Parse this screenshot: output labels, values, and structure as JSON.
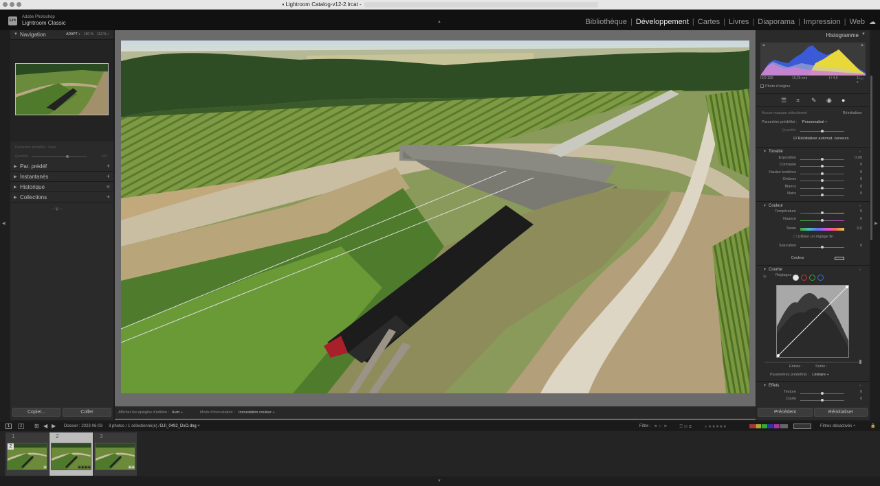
{
  "window": {
    "title": "Lightroom Catalog-v12-2.lrcat -"
  },
  "app": {
    "logo": "Lrc",
    "brand_top": "Adobe Photoshop",
    "brand_bottom": "Lightroom Classic"
  },
  "modules": [
    {
      "label": "Bibliothèque",
      "active": false
    },
    {
      "label": "Développement",
      "active": true
    },
    {
      "label": "Cartes",
      "active": false
    },
    {
      "label": "Livres",
      "active": false
    },
    {
      "label": "Diaporama",
      "active": false
    },
    {
      "label": "Impression",
      "active": false
    },
    {
      "label": "Web",
      "active": false
    }
  ],
  "left_panel": {
    "navigation": {
      "title": "Navigation",
      "zoom": [
        "ADAPT ÷",
        "100 %",
        "113 % ÷"
      ]
    },
    "preset_box": {
      "label": "Paramètre prédéfini : Sans",
      "amount_label": "Quantité",
      "amount_value": "100"
    },
    "sections": [
      {
        "title": "Par. prédéf",
        "action": "+"
      },
      {
        "title": "Instantanés",
        "action": "+"
      },
      {
        "title": "Historique",
        "action": "×"
      },
      {
        "title": "Collections",
        "action": "+"
      }
    ],
    "copy": "Copier...",
    "paste": "Coller"
  },
  "toolbar": {
    "pins_label": "Afficher les épingles d'édition :",
    "pins_value": "Auto ÷",
    "overlay_label": "Mode d'incrustation :",
    "overlay_value": "Incrustation couleur ÷"
  },
  "right_panel": {
    "histogram": {
      "title": "Histogramme",
      "iso": "ISO 100",
      "focal": "10,26 mm",
      "aperture": "f / 4,0",
      "shutter": "1/₁₀₀ s",
      "original": "Photo d'origine"
    },
    "mask": {
      "label": "Aucun masque sélectionné",
      "reset": "Réinitialiser",
      "preset_label": "Paramètre prédéfini :",
      "preset_value": "Personnalisé ÷",
      "amount_label": "Quantité",
      "auto_reset": "Réinitialiser automat. curseurs"
    },
    "tonalite": {
      "title": "Tonalité",
      "sliders": [
        {
          "label": "Exposition",
          "value": "0,00"
        },
        {
          "label": "Contraste",
          "value": "0"
        },
        {
          "label": "Hautes lumières",
          "value": "0"
        },
        {
          "label": "Ombres",
          "value": "0"
        },
        {
          "label": "Blancs",
          "value": "0"
        },
        {
          "label": "Noirs",
          "value": "0"
        }
      ]
    },
    "couleur": {
      "title": "Couleur",
      "temp_label": "Température",
      "temp_value": "0",
      "nuance_label": "Nuance",
      "nuance_value": "0",
      "teinte_label": "Teinte",
      "teinte_value": "0,0",
      "fine": "Utiliser un réglage fin",
      "sat_label": "Saturation",
      "sat_value": "0",
      "color_label": "Couleur"
    },
    "courbe": {
      "title": "Courbe",
      "reglages": "Réglages :",
      "entree": "Entrée :",
      "sortie": "Sortie :",
      "preset_label": "Paramètres prédéfinis :",
      "preset_value": "Linéaire ÷",
      "channels": [
        "#e8e8e8",
        "#d33030",
        "#3aa83a",
        "#3a70d8"
      ]
    },
    "effets": {
      "title": "Effets",
      "sliders": [
        {
          "label": "Texture",
          "value": "0"
        },
        {
          "label": "Clarté",
          "value": "0"
        }
      ]
    },
    "previous": "Précédent",
    "reset": "Réinitialiser"
  },
  "filmstrip_bar": {
    "folder": "Dossier : 2023-06-03",
    "selection": "3 photos / 1 sélectionné(e) /",
    "filename": "DJI_0492_DxO.dng ÷",
    "filter_label": "Filtre :",
    "filter_value": "Filtres désactivés ÷"
  },
  "filmstrip": [
    {
      "num": "1",
      "badge": "2"
    },
    {
      "num": "2",
      "badge": ""
    },
    {
      "num": "3",
      "badge": ""
    }
  ]
}
